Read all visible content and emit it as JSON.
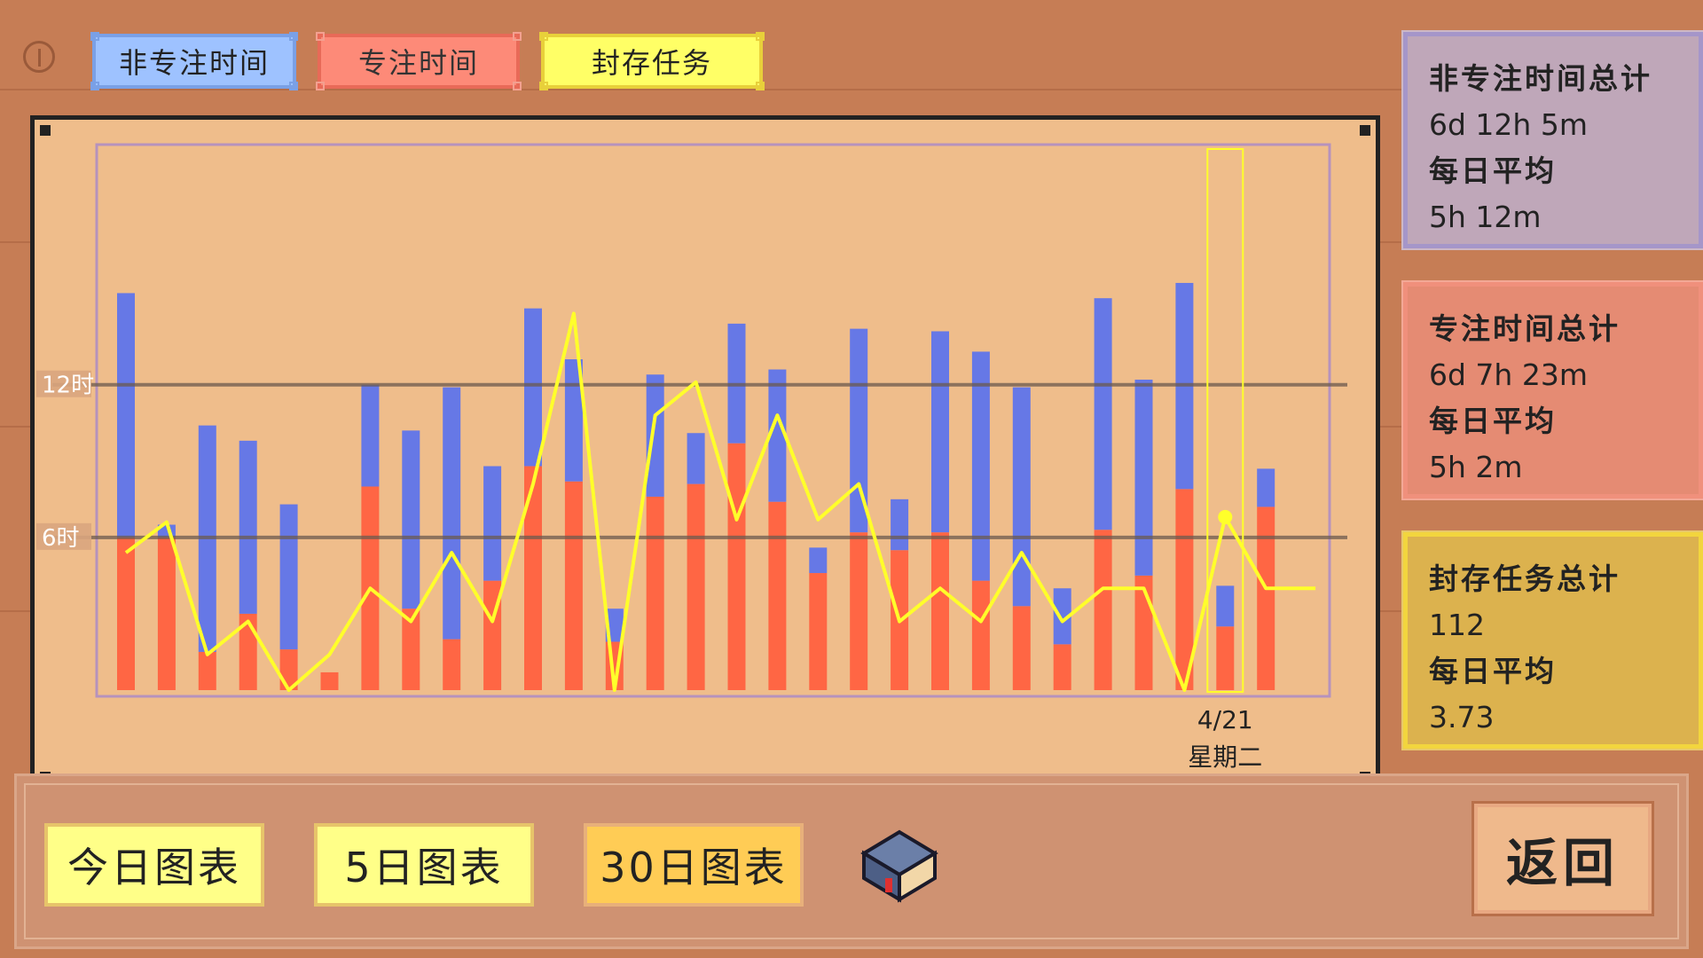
{
  "legend": {
    "non_focus": "非专注时间",
    "focus": "专注时间",
    "archived": "封存任务"
  },
  "colors": {
    "non_focus": "#6678e6",
    "focus": "#ff6644",
    "archived_line": "#ffff2a",
    "legend_non_focus_bg": "#9ec2ff",
    "legend_focus_bg": "#fd8a78",
    "legend_archived_bg": "#ffff66"
  },
  "stats": {
    "non_focus": {
      "title": "非专注时间总计",
      "total": "6d 12h 5m",
      "avg_label": "每日平均",
      "avg": "5h 12m"
    },
    "focus": {
      "title": "专注时间总计",
      "total": "6d 7h 23m",
      "avg_label": "每日平均",
      "avg": "5h 2m"
    },
    "archived": {
      "title": "封存任务总计",
      "total": "112",
      "avg_label": "每日平均",
      "avg": "3.73"
    }
  },
  "chart_data": {
    "type": "bar",
    "stacked": true,
    "y_unit": "hours",
    "ylim": [
      0,
      20.6
    ],
    "gridlines": [
      {
        "value": 6,
        "label": "6时"
      },
      {
        "value": 12,
        "label": "12时"
      }
    ],
    "days": 30,
    "series": [
      {
        "name": "专注时间",
        "values": [
          6,
          6,
          1.5,
          3,
          1.6,
          0.7,
          8,
          3.2,
          2,
          4.3,
          8.8,
          8.2,
          1.9,
          7.6,
          8.1,
          9.7,
          7.4,
          4.6,
          6.2,
          5.5,
          6.2,
          4.3,
          3.3,
          1.8,
          6.3,
          4.5,
          7.9,
          2.5,
          7.2,
          0
        ],
        "line_for_total": false
      },
      {
        "name": "非专注时间",
        "values": [
          9.6,
          0.5,
          8.9,
          6.8,
          5.7,
          0,
          4,
          7,
          9.9,
          4.5,
          6.2,
          4.8,
          1.3,
          4.8,
          2,
          4.7,
          5.2,
          1,
          8,
          2,
          7.9,
          9,
          8.6,
          2.2,
          9.1,
          7.7,
          8.1,
          1.6,
          1.5,
          0
        ]
      }
    ],
    "line_series": {
      "name": "封存任务",
      "values": [
        5.4,
        6.6,
        1.4,
        2.7,
        0,
        1.4,
        4,
        2.7,
        5.4,
        2.7,
        8.1,
        14.8,
        0,
        10.8,
        12.1,
        6.7,
        10.8,
        6.7,
        8.1,
        2.7,
        4,
        2.7,
        5.4,
        2.7,
        4,
        4,
        0,
        6.8,
        4,
        4
      ]
    },
    "selected": {
      "index": 27,
      "date": "4/21",
      "weekday": "星期二"
    }
  },
  "buttons": {
    "today": "今日图表",
    "five_day": "5日图表",
    "thirty_day": "30日图表",
    "back": "返回"
  }
}
